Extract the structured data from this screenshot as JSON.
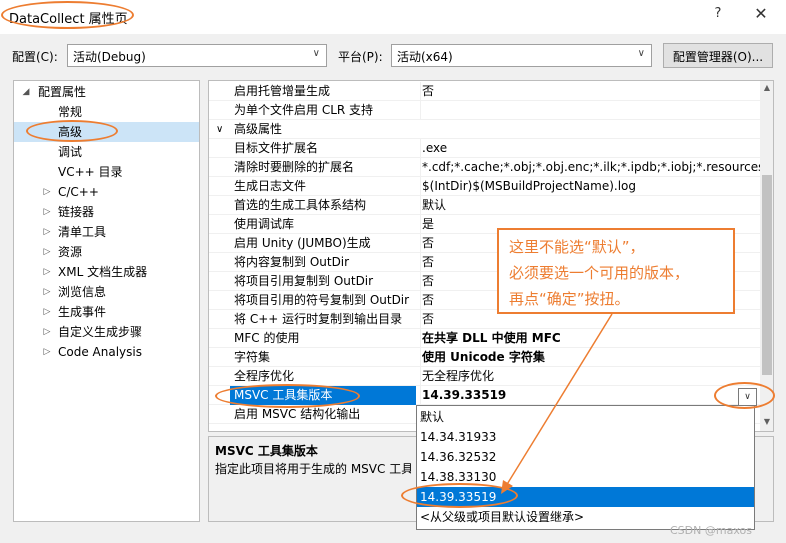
{
  "window": {
    "title": "DataCollect 属性页",
    "help_label": "?",
    "close_label": "✕"
  },
  "toolbar": {
    "config_label": "配置(C):",
    "config_value": "活动(Debug)",
    "platform_label": "平台(P):",
    "platform_value": "活动(x64)",
    "config_manager_label": "配置管理器(O)..."
  },
  "tree": {
    "items": [
      {
        "label": "配置属性",
        "twisty": "◢"
      },
      {
        "label": "常规",
        "twisty": ""
      },
      {
        "label": "高级",
        "twisty": ""
      },
      {
        "label": "调试",
        "twisty": ""
      },
      {
        "label": "VC++ 目录",
        "twisty": ""
      },
      {
        "label": "C/C++",
        "twisty": "▷"
      },
      {
        "label": "链接器",
        "twisty": "▷"
      },
      {
        "label": "清单工具",
        "twisty": "▷"
      },
      {
        "label": "资源",
        "twisty": "▷"
      },
      {
        "label": "XML 文档生成器",
        "twisty": "▷"
      },
      {
        "label": "浏览信息",
        "twisty": "▷"
      },
      {
        "label": "生成事件",
        "twisty": "▷"
      },
      {
        "label": "自定义生成步骤",
        "twisty": "▷"
      },
      {
        "label": "Code Analysis",
        "twisty": "▷"
      }
    ]
  },
  "grid": {
    "rows": [
      {
        "name": "启用托管增量生成",
        "value": "否"
      },
      {
        "name": "为单个文件启用 CLR 支持",
        "value": ""
      },
      {
        "name": "高级属性",
        "value": "",
        "category": true,
        "twisty": "∨"
      },
      {
        "name": "目标文件扩展名",
        "value": ".exe"
      },
      {
        "name": "清除时要删除的扩展名",
        "value": "*.cdf;*.cache;*.obj;*.obj.enc;*.ilk;*.ipdb;*.iobj;*.resources;*.tl"
      },
      {
        "name": "生成日志文件",
        "value": "$(IntDir)$(MSBuildProjectName).log"
      },
      {
        "name": "首选的生成工具体系结构",
        "value": "默认"
      },
      {
        "name": "使用调试库",
        "value": "是"
      },
      {
        "name": "启用 Unity (JUMBO)生成",
        "value": "否"
      },
      {
        "name": "将内容复制到 OutDir",
        "value": "否"
      },
      {
        "name": "将项目引用复制到 OutDir",
        "value": "否"
      },
      {
        "name": "将项目引用的符号复制到 OutDir",
        "value": "否"
      },
      {
        "name": "将 C++ 运行时复制到输出目录",
        "value": "否"
      },
      {
        "name": "MFC 的使用",
        "value": "在共享 DLL 中使用 MFC",
        "bold": true
      },
      {
        "name": "字符集",
        "value": "使用 Unicode 字符集",
        "bold": true
      },
      {
        "name": "全程序优化",
        "value": "无全程序优化"
      },
      {
        "name": "MSVC 工具集版本",
        "value": "14.39.33519",
        "selected": true
      },
      {
        "name": "启用 MSVC 结构化输出",
        "value": ""
      }
    ]
  },
  "description": {
    "title": "MSVC 工具集版本",
    "text": "指定此项目将用于生成的 MSVC 工具集"
  },
  "dropdown": {
    "options": [
      {
        "label": "默认"
      },
      {
        "label": "14.34.31933"
      },
      {
        "label": "14.36.32532"
      },
      {
        "label": "14.38.33130"
      },
      {
        "label": "14.39.33519",
        "selected": true
      },
      {
        "label": "<从父级或项目默认设置继承>"
      }
    ]
  },
  "callout": {
    "lines": [
      "这里不能选“默认”，",
      "必须要选一个可用的版本，",
      "再点“确定”按扭。"
    ]
  },
  "watermark": "CSDN @maxos",
  "colors": {
    "accent": "#0078d7",
    "annotation": "#ed7d31",
    "tree_selected": "#cce4f7"
  }
}
